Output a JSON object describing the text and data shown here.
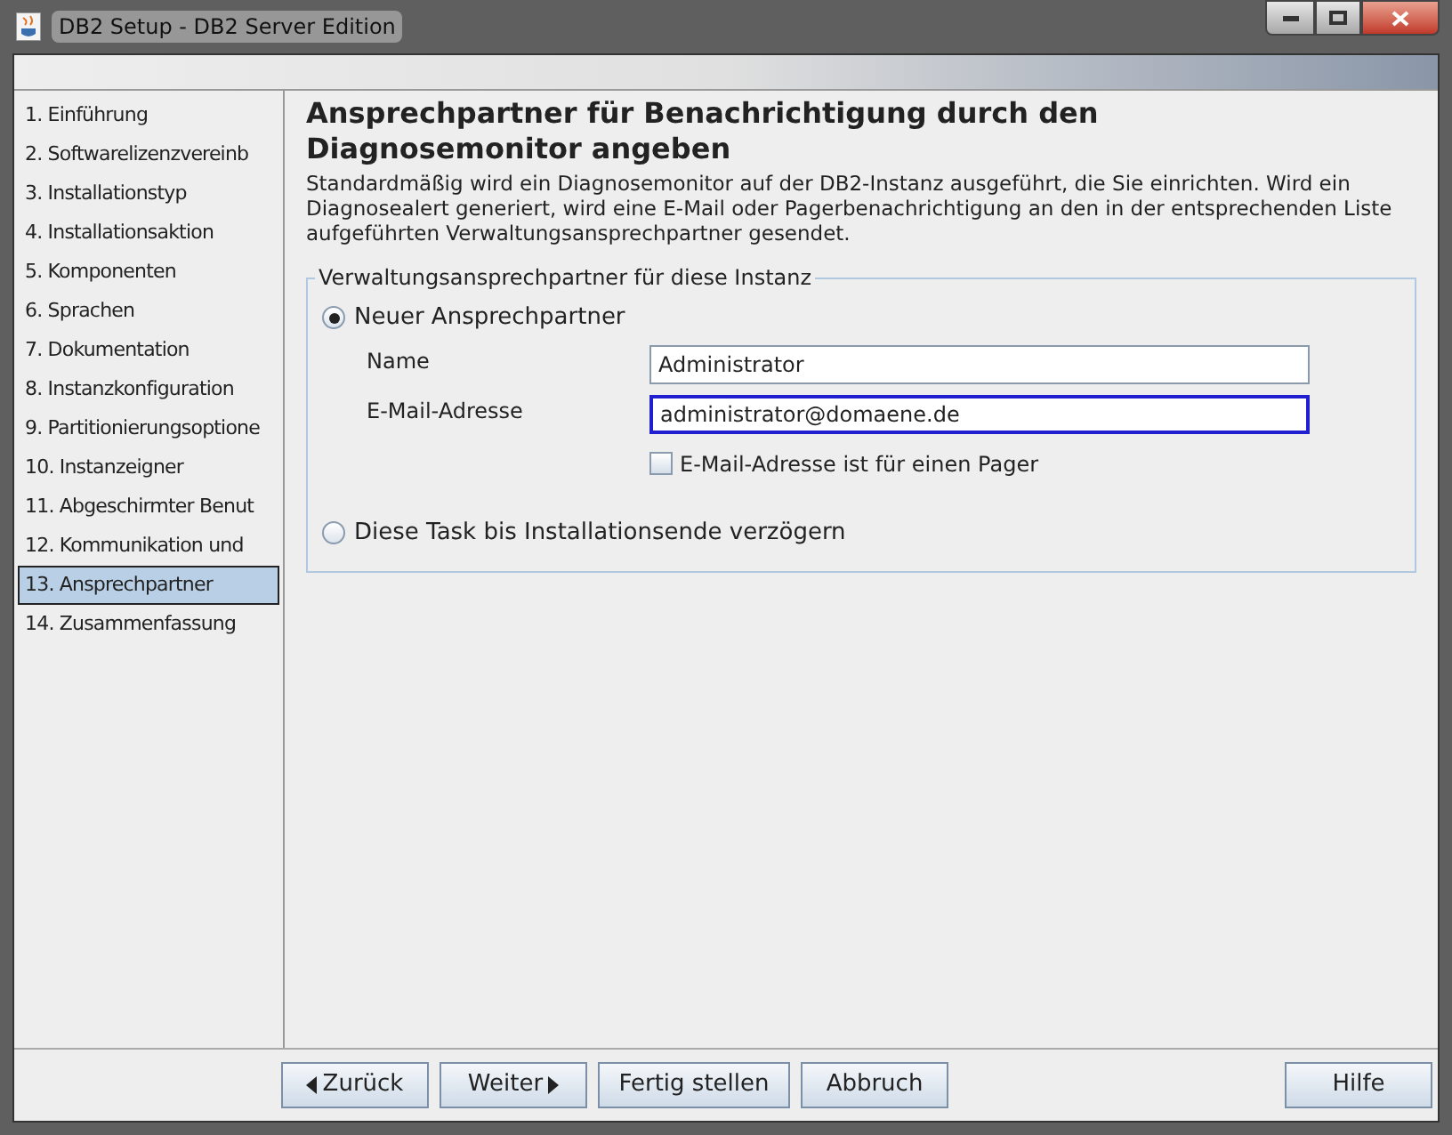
{
  "window": {
    "title": "DB2 Setup - DB2 Server Edition"
  },
  "sidebar": {
    "items": [
      {
        "label": "1. Einführung",
        "selected": false
      },
      {
        "label": "2. Softwarelizenzvereinb",
        "selected": false
      },
      {
        "label": "3. Installationstyp",
        "selected": false
      },
      {
        "label": "4. Installationsaktion",
        "selected": false
      },
      {
        "label": "5. Komponenten",
        "selected": false
      },
      {
        "label": "6. Sprachen",
        "selected": false
      },
      {
        "label": "7. Dokumentation",
        "selected": false
      },
      {
        "label": "8. Instanzkonfiguration",
        "selected": false
      },
      {
        "label": "9. Partitionierungsoptione",
        "selected": false
      },
      {
        "label": "10. Instanzeigner",
        "selected": false
      },
      {
        "label": "11. Abgeschirmter Benut",
        "selected": false
      },
      {
        "label": "12. Kommunikation und",
        "selected": false
      },
      {
        "label": "13. Ansprechpartner",
        "selected": true
      },
      {
        "label": "14. Zusammenfassung",
        "selected": false
      }
    ]
  },
  "main": {
    "heading": "Ansprechpartner für Benachrichtigung durch den Diagnosemonitor angeben",
    "description": "Standardmäßig wird ein Diagnosemonitor auf der DB2-Instanz ausgeführt, die Sie einrichten. Wird ein Diagnosealert generiert, wird eine E-Mail oder Pagerbenachrichtigung an den in der entsprechenden Liste aufgeführten Verwaltungsansprechpartner gesendet.",
    "group": {
      "title": "Verwaltungsansprechpartner für diese Instanz",
      "option_new": {
        "label": "Neuer Ansprechpartner",
        "selected": true
      },
      "fields": [
        {
          "label": "Name",
          "value": "Administrator",
          "focused": false
        },
        {
          "label": "E-Mail-Adresse",
          "value": "administrator@domaene.de",
          "focused": true
        }
      ],
      "pager": {
        "label": "E-Mail-Adresse ist für einen Pager",
        "checked": false
      },
      "option_defer": {
        "label": "Diese Task bis Installationsende verzögern",
        "selected": false
      }
    }
  },
  "buttons": [
    {
      "label": "Zurück",
      "kind": "back"
    },
    {
      "label": "Weiter",
      "kind": "next"
    },
    {
      "label": "Fertig stellen",
      "kind": "plain"
    },
    {
      "label": "Abbruch",
      "kind": "plain"
    }
  ],
  "help_button": "Hilfe"
}
